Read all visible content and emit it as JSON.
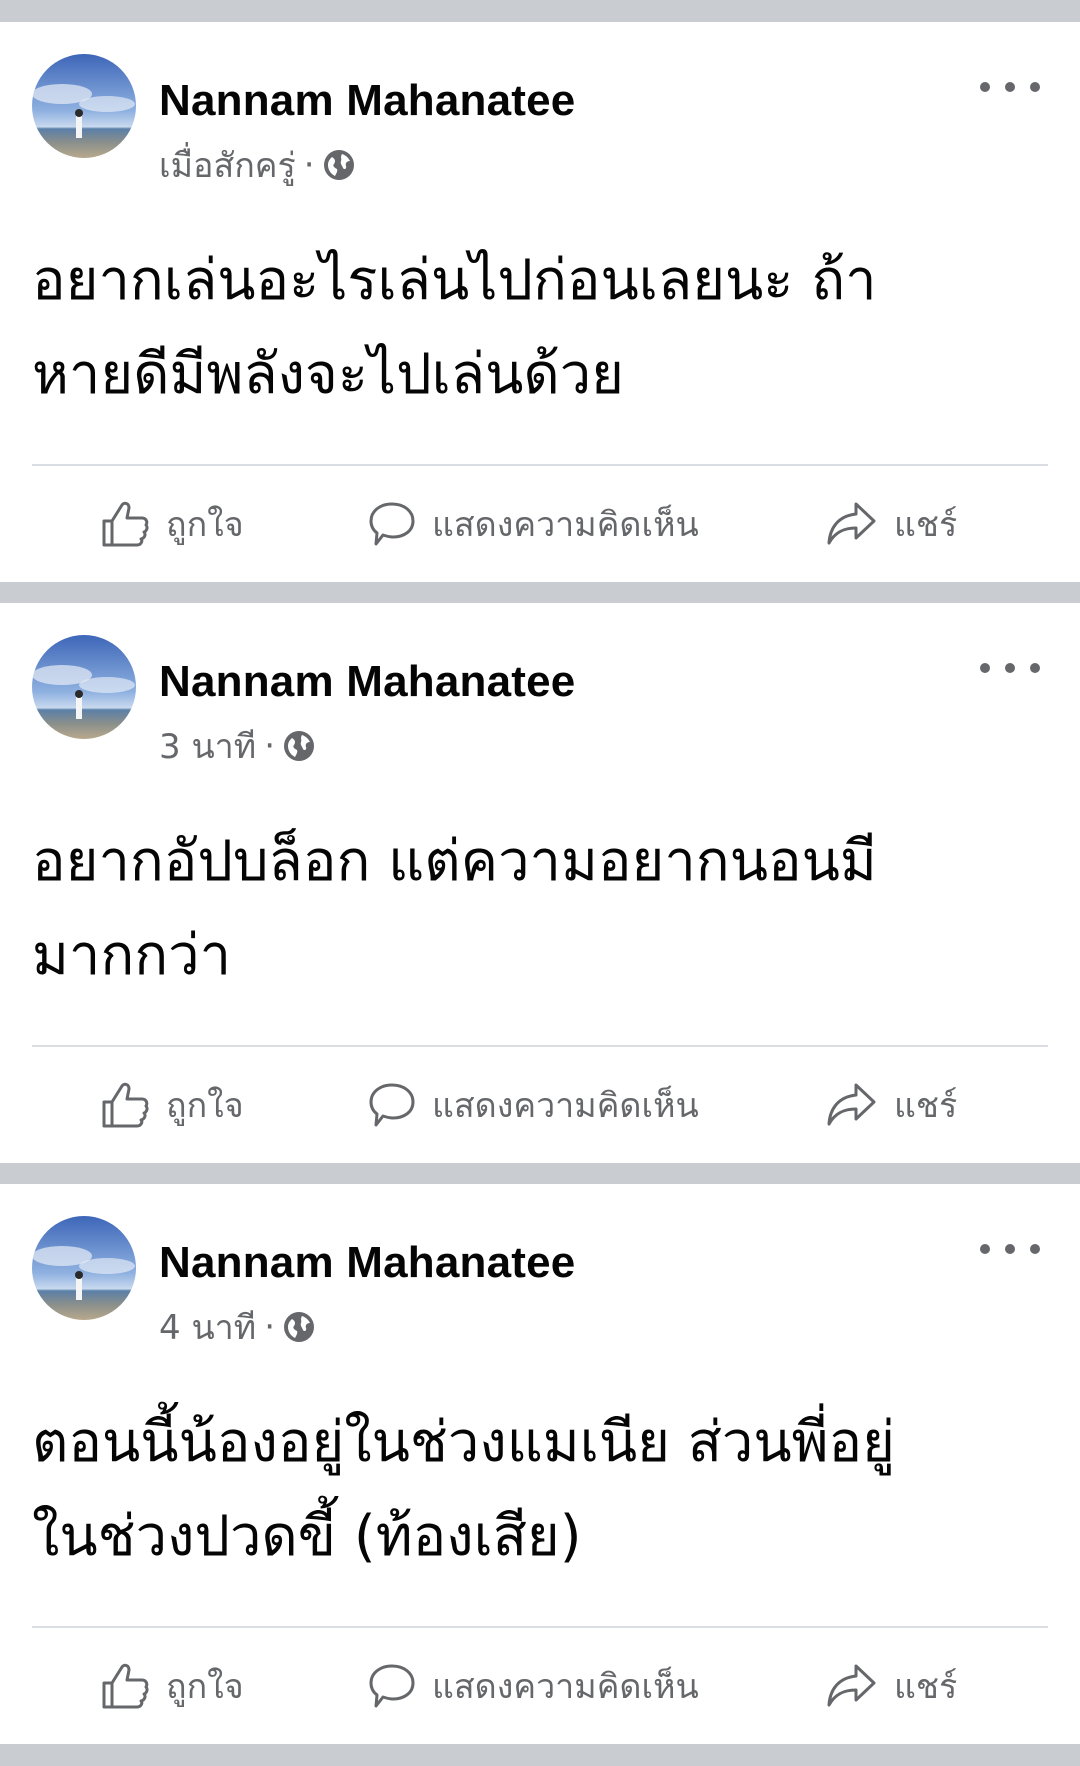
{
  "colors": {
    "background": "#c9ccd1",
    "card": "#ffffff",
    "text_primary": "#050505",
    "text_secondary": "#65676b",
    "divider": "#dadde1"
  },
  "icons": {
    "privacy": "globe-icon",
    "menu": "more-horizontal-icon",
    "like": "thumbs-up-icon",
    "comment": "speech-bubble-icon",
    "share": "share-arrow-icon"
  },
  "posts": [
    {
      "author": "Nannam Mahanatee",
      "time": "เมื่อสักครู่",
      "separator": "·",
      "text_lines": [
        "อยากเล่นอะไรเล่นไปก่อนเลยนะ ถ้า",
        "หายดีมีพลังจะไปเล่นด้วย"
      ],
      "actions": {
        "like": "ถูกใจ",
        "comment": "แสดงความคิดเห็น",
        "share": "แชร์"
      }
    },
    {
      "author": "Nannam Mahanatee",
      "time": "3 นาที",
      "separator": "·",
      "text_lines": [
        "อยากอัปบล็อก แต่ความอยากนอนมี",
        "มากกว่า"
      ],
      "actions": {
        "like": "ถูกใจ",
        "comment": "แสดงความคิดเห็น",
        "share": "แชร์"
      }
    },
    {
      "author": "Nannam Mahanatee",
      "time": "4 นาที",
      "separator": "·",
      "text_lines": [
        "ตอนนี้น้องอยู่ในช่วงแมเนีย ส่วนพี่อยู่",
        "ในช่วงปวดขี้ (ท้องเสีย)"
      ],
      "actions": {
        "like": "ถูกใจ",
        "comment": "แสดงความคิดเห็น",
        "share": "แชร์"
      }
    }
  ]
}
